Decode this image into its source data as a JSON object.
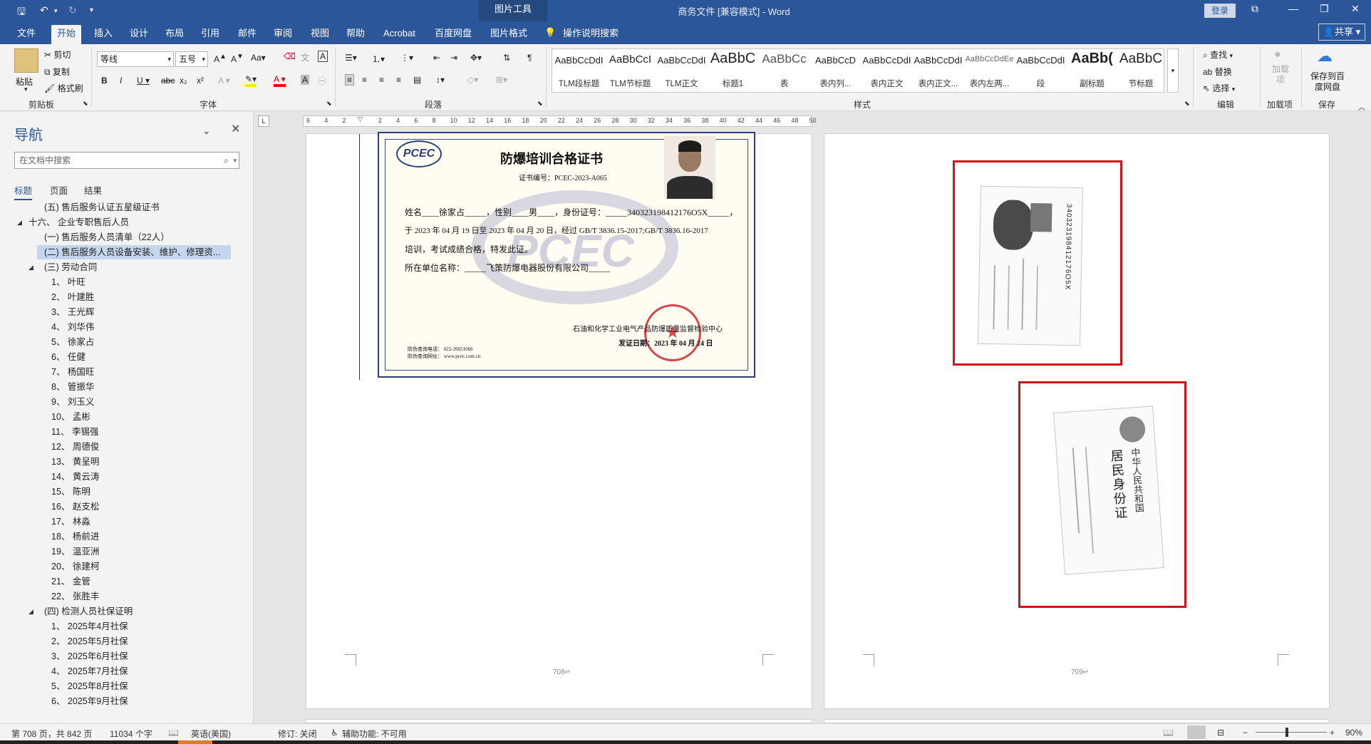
{
  "window": {
    "title": "商务文件 [兼容模式]  -  Word",
    "context_tab_group": "图片工具",
    "login": "登录"
  },
  "tabs": [
    {
      "label": "文件"
    },
    {
      "label": "开始"
    },
    {
      "label": "插入"
    },
    {
      "label": "设计"
    },
    {
      "label": "布局"
    },
    {
      "label": "引用"
    },
    {
      "label": "邮件"
    },
    {
      "label": "审阅"
    },
    {
      "label": "视图"
    },
    {
      "label": "帮助"
    },
    {
      "label": "Acrobat"
    },
    {
      "label": "百度网盘"
    },
    {
      "label": "图片格式"
    }
  ],
  "tell_me": "操作说明搜索",
  "share": "共享",
  "ribbon": {
    "clipboard": {
      "paste": "粘贴",
      "cut": "剪切",
      "copy": "复制",
      "format_painter": "格式刷",
      "label": "剪贴板"
    },
    "font": {
      "font_name": "等线",
      "font_size": "五号",
      "label": "字体"
    },
    "paragraph": {
      "label": "段落"
    },
    "styles": {
      "label": "样式",
      "items": [
        {
          "preview": "AaBbCcDdI",
          "name": "TLM段标题"
        },
        {
          "preview": "AaBbCcI",
          "name": "TLM节标题"
        },
        {
          "preview": "AaBbCcDdI",
          "name": "TLM正文"
        },
        {
          "preview": "AaBbC",
          "name": "标题1"
        },
        {
          "preview": "AaBbCc",
          "name": "表"
        },
        {
          "preview": "AaBbCcD",
          "name": "表内列..."
        },
        {
          "preview": "AaBbCcDdI",
          "name": "表内正文"
        },
        {
          "preview": "AaBbCcDdI",
          "name": "表内正文..."
        },
        {
          "preview": "AaBbCcDdEe",
          "name": "表内左两..."
        },
        {
          "preview": "AaBbCcDdI",
          "name": "段"
        },
        {
          "preview": "AaBb(",
          "name": "副标题"
        },
        {
          "preview": "AaBbC",
          "name": "节标题"
        }
      ]
    },
    "editing": {
      "find": "查找",
      "replace": "替换",
      "select": "选择",
      "label": "编辑"
    },
    "addins": {
      "addin": "加载项",
      "label": "加载项"
    },
    "save": {
      "save_to": "保存到百度网盘",
      "label": "保存"
    }
  },
  "nav": {
    "title": "导航",
    "search_placeholder": "在文档中搜索",
    "tabs": [
      "标题",
      "页面",
      "结果"
    ],
    "items": [
      {
        "text": "(五)  售后服务认证五星级证书",
        "level": 2
      },
      {
        "text": "十六、 企业专职售后人员",
        "level": 1,
        "arrow": "◢"
      },
      {
        "text": "(一)  售后服务人员清单（22人）",
        "level": 2
      },
      {
        "text": "(二)  售后服务人员设备安装、维护、修理资...",
        "level": 2,
        "selected": true
      },
      {
        "text": "(三)  劳动合同",
        "level": 2,
        "arrow": "◢"
      },
      {
        "text": "1、 叶旺",
        "level": 3
      },
      {
        "text": "2、 叶建胜",
        "level": 3
      },
      {
        "text": "3、 王光辉",
        "level": 3
      },
      {
        "text": "4、 刘华伟",
        "level": 3
      },
      {
        "text": "5、 徐家占",
        "level": 3
      },
      {
        "text": "6、 任健",
        "level": 3
      },
      {
        "text": "7、 杨国旺",
        "level": 3
      },
      {
        "text": "8、 管振华",
        "level": 3
      },
      {
        "text": "9、 刘玉义",
        "level": 3
      },
      {
        "text": "10、 孟彬",
        "level": 3
      },
      {
        "text": "11、 李锡强",
        "level": 3
      },
      {
        "text": "12、 周德俊",
        "level": 3
      },
      {
        "text": "13、 黄呈明",
        "level": 3
      },
      {
        "text": "14、 黄云涛",
        "level": 3
      },
      {
        "text": "15、 陈明",
        "level": 3
      },
      {
        "text": "16、 赵支松",
        "level": 3
      },
      {
        "text": "17、 林淼",
        "level": 3
      },
      {
        "text": "18、 杨前进",
        "level": 3
      },
      {
        "text": "19、 温亚洲",
        "level": 3
      },
      {
        "text": "20、 徐建柯",
        "level": 3
      },
      {
        "text": "21、 金管",
        "level": 3
      },
      {
        "text": "22、 张胜丰",
        "level": 3
      },
      {
        "text": "(四)  检测人员社保证明",
        "level": 2,
        "arrow": "◢"
      },
      {
        "text": "1、 2025年4月社保",
        "level": 3
      },
      {
        "text": "2、 2025年5月社保",
        "level": 3
      },
      {
        "text": "3、 2025年6月社保",
        "level": 3
      },
      {
        "text": "4、 2025年7月社保",
        "level": 3
      },
      {
        "text": "5、 2025年8月社保",
        "level": 3
      },
      {
        "text": "6、 2025年9月社保",
        "level": 3
      }
    ]
  },
  "ruler": [
    "6",
    "4",
    "2",
    "",
    "2",
    "4",
    "6",
    "8",
    "10",
    "12",
    "14",
    "16",
    "18",
    "20",
    "22",
    "24",
    "26",
    "28",
    "30",
    "32",
    "34",
    "36",
    "38",
    "40",
    "42",
    "44",
    "46",
    "48",
    "50"
  ],
  "certificate": {
    "logo": "PCEC",
    "title": "防爆培训合格证书",
    "number": "证书编号：PCEC-2023-A065",
    "line1": "姓名____徐家占_____，性别____男____，身份证号：_____340323198412176O5X_____，",
    "line2": "于 2023 年 04 月 19 日至 2023 年 04 月 20 日，经过  GB/T 3836.15-2017;GB/T 3836.16-2017",
    "line3": "培训，考试成绩合格，特发此证。",
    "line4": "所在单位名称：_____飞策防爆电器股份有限公司_____",
    "issuer": "石油和化学工业电气产品防爆质量监督检验中心",
    "date": "发证日期：2023 年 04 月 24 日",
    "phone": "防伪查询电话：  022-26651066",
    "web": "防伪查询网址：  www.pcec.com.cn"
  },
  "id_card": {
    "number": "340323198412176O5X",
    "front_title": "中华人民共和国",
    "front_sub": "居民身份证"
  },
  "pages": {
    "left_number": "708",
    "right_number": "709"
  },
  "status": {
    "page": "第 708 页，共 842 页",
    "words": "11034 个字",
    "language": "英语(美国)",
    "track": "修订: 关闭",
    "accessibility": "辅助功能: 不可用",
    "zoom": "90%"
  }
}
